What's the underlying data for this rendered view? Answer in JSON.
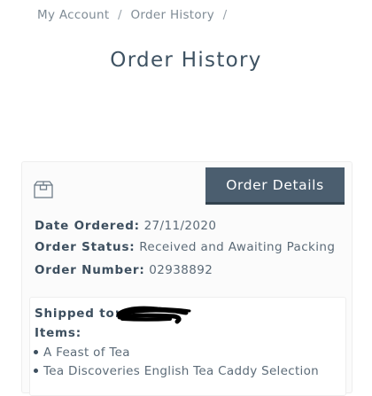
{
  "breadcrumb": {
    "items": [
      "My Account",
      "Order History"
    ],
    "separator": "/"
  },
  "page": {
    "title": "Order History"
  },
  "order": {
    "details_button": "Order Details",
    "date_label": "Date Ordered:",
    "date_value": "27/11/2020",
    "status_label": "Order Status:",
    "status_value": "Received and Awaiting Packing",
    "number_label": "Order Number:",
    "number_value": "02938892",
    "shipped_label": "Shipped to:",
    "items_label": "Items:",
    "items": [
      "A Feast of Tea",
      "Tea Discoveries English Tea Caddy Selection"
    ]
  },
  "colors": {
    "button_bg": "#4b5e6f",
    "text_dark": "#3d4f5f",
    "text_muted": "#7f8b95"
  }
}
